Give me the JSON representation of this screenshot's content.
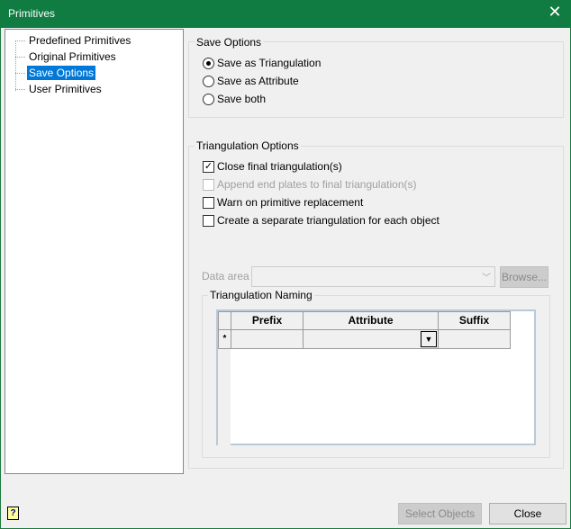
{
  "window": {
    "title": "Primitives",
    "close_icon": "close-icon"
  },
  "tree": {
    "items": [
      {
        "label": "Predefined Primitives",
        "selected": false
      },
      {
        "label": "Original Primitives",
        "selected": false
      },
      {
        "label": "Save Options",
        "selected": true
      },
      {
        "label": "User Primitives",
        "selected": false
      }
    ]
  },
  "save_options": {
    "title": "Save Options",
    "options": [
      {
        "label": "Save as Triangulation",
        "checked": true
      },
      {
        "label": "Save as Attribute",
        "checked": false
      },
      {
        "label": "Save both",
        "checked": false
      }
    ]
  },
  "triangulation_options": {
    "title": "Triangulation Options",
    "checks": [
      {
        "label": "Close final triangulation(s)",
        "checked": true,
        "enabled": true
      },
      {
        "label": "Append end plates to final triangulation(s)",
        "checked": false,
        "enabled": false
      },
      {
        "label": "Warn on primitive replacement",
        "checked": false,
        "enabled": true
      },
      {
        "label": "Create a separate triangulation for each object",
        "checked": false,
        "enabled": true
      }
    ],
    "data_area_label": "Data area",
    "data_area_value": "",
    "browse_label": "Browse...",
    "naming": {
      "title": "Triangulation Naming",
      "columns": [
        "Prefix",
        "Attribute",
        "Suffix"
      ],
      "new_row_marker": "*"
    }
  },
  "footer": {
    "help_icon": "help-icon",
    "select_objects_label": "Select Objects",
    "close_label": "Close"
  }
}
